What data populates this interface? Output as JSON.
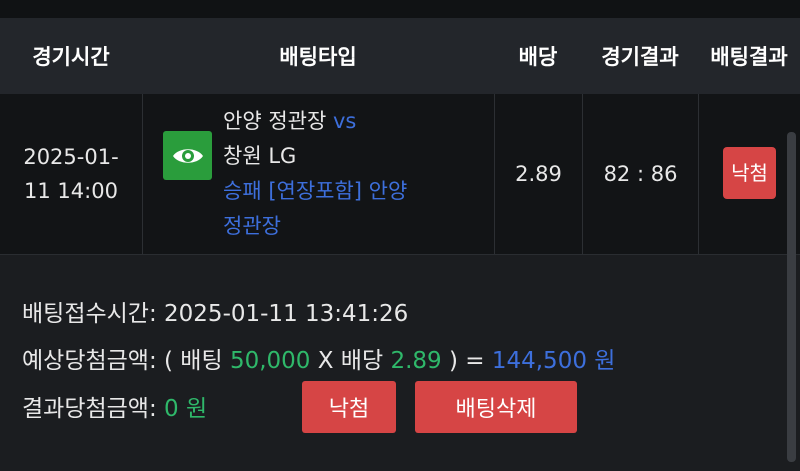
{
  "header": {
    "col_time": "경기시간",
    "col_bettype": "배팅타입",
    "col_odds": "배당",
    "col_game_result": "경기결과",
    "col_bet_result": "배팅결과"
  },
  "row": {
    "time_line1": "2025-01-",
    "time_line2": "11 14:00",
    "home_team": "안양 정관장",
    "vs": "vs",
    "away_team": "창원 LG",
    "bet_desc_line1": "승패 [연장포함] 안양",
    "bet_desc_line2": "정관장",
    "odds": "2.89",
    "score": "82 : 86",
    "bet_result": "낙첨",
    "icon": "eye-icon"
  },
  "detail": {
    "received_label": "배팅접수시간:",
    "received_value": "2025-01-11 13:41:26",
    "expected_label": "예상당첨금액: ( 배팅",
    "stake": "50,000",
    "x_odds_label": "X 배당",
    "odds": "2.89",
    "equals": ") =",
    "expected_amount": "144,500 원",
    "actual_label": "결과당첨금액:",
    "actual_amount": "0 원",
    "lost_button": "낙첨",
    "delete_button": "배팅삭제"
  },
  "colors": {
    "accent_red": "#d64545",
    "link_blue": "#3d6fdc",
    "value_green": "#2fb86a",
    "icon_green": "#2a9d3c"
  }
}
